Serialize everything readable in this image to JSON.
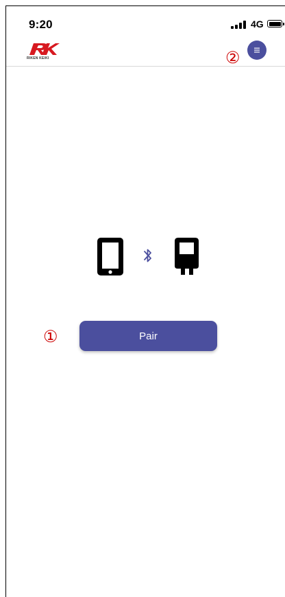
{
  "status_bar": {
    "time": "9:20",
    "network": "4G",
    "signal_bars": 4,
    "battery_level": 1.0
  },
  "header": {
    "logo_text": "RIKEN KEIKI",
    "logo_icon": "rk-logo",
    "menu_icon": "hamburger-menu-icon",
    "menu_marker": "②"
  },
  "main": {
    "phone_icon": "smartphone-icon",
    "bluetooth_icon": "bluetooth-icon",
    "device_icon": "gas-detector-icon",
    "pair_label": "Pair",
    "pair_marker": "①"
  },
  "colors": {
    "accent": "#4b4f9e",
    "marker": "#cc0000",
    "logo_red": "#d71920"
  }
}
